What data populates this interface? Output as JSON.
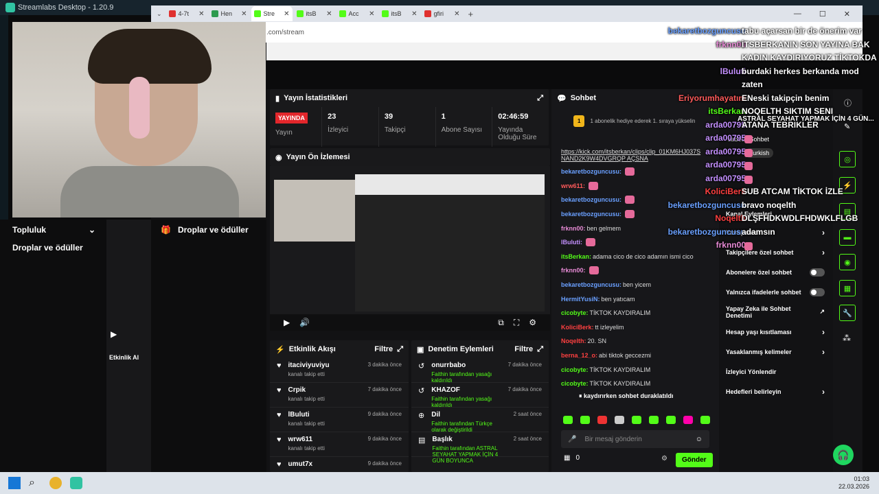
{
  "app": {
    "title": "Streamlabs Desktop - 1.20.9"
  },
  "browser": {
    "tabs": [
      "4-7t",
      "Hen",
      "Stre",
      "itsB",
      "Acc",
      "itsB",
      "gfiri"
    ],
    "url": ".com/stream"
  },
  "left": {
    "items": [
      "Topluluk",
      "Droplar ve ödüller"
    ],
    "mid_item": "Droplar ve ödüller",
    "activity_label": "Etkinlik Al"
  },
  "stats": {
    "title": "Yayın İstatistikleri",
    "live": "YAYINDA",
    "stream": "Yayın",
    "viewers_v": "23",
    "viewers": "İzleyici",
    "followers_v": "39",
    "followers": "Takipçi",
    "subs_v": "1",
    "subs": "Abone Sayısı",
    "dur_v": "02:46:59",
    "dur": "Yayında Olduğu Süre"
  },
  "preview": {
    "title": "Yayın Ön İzlemesi"
  },
  "feed": {
    "title": "Etkinlik Akışı",
    "filter": "Filtre",
    "items": [
      {
        "name": "itaciviyuviyu",
        "sub": "kanalı takip etti",
        "time": "3 dakika önce"
      },
      {
        "name": "Crpik",
        "sub": "kanalı takip etti",
        "time": "7 dakika önce"
      },
      {
        "name": "lBuluti",
        "sub": "kanalı takip etti",
        "time": "9 dakika önce"
      },
      {
        "name": "wrw611",
        "sub": "kanalı takip etti",
        "time": "9 dakika önce"
      },
      {
        "name": "umut7x",
        "sub": "",
        "time": "9 dakika önce"
      }
    ]
  },
  "mod": {
    "title": "Denetim Eylemleri",
    "filter": "Filtre",
    "items": [
      {
        "name": "onurrbabo",
        "sub": "Faithin tarafından yasağı kaldırıldı",
        "time": "7 dakika önce"
      },
      {
        "name": "KHAZOF",
        "sub": "Faithin tarafından yasağı kaldırıldı",
        "time": "7 dakika önce"
      },
      {
        "name": "Dil",
        "sub": "Faithin tarafından Türkçe olarak değiştirildi",
        "time": "2 saat önce"
      },
      {
        "name": "Başlık",
        "sub": "Faithin tarafından ASTRAL SEYAHAT YAPMAK İÇİN 4 GÜN BOYUNCA",
        "time": "2 saat önce"
      }
    ]
  },
  "chat": {
    "title": "Sohbet",
    "pinned": "1 abonelik hediye ederek 1. sıraya yükselin",
    "paused": "kaydırırken sohbet duraklatıldı",
    "placeholder": "Bir mesaj gönderin",
    "count": "0",
    "send": "Gönder",
    "messages": [
      {
        "u": "",
        "t": "https://kick.com/itsberkan/clips/clip_01KM6HJ037S NAND2K9W4DVGRQP AÇSNA",
        "c": "#ddd"
      },
      {
        "u": "bekaretbozguncusu:",
        "t": "",
        "c": "#6aa0ff"
      },
      {
        "u": "wrw611:",
        "t": "",
        "c": "#ff5a5a"
      },
      {
        "u": "bekaretbozguncusu:",
        "t": "",
        "c": "#6aa0ff"
      },
      {
        "u": "bekaretbozguncusu:",
        "t": "",
        "c": "#6aa0ff"
      },
      {
        "u": "frknn00:",
        "t": "ben gelmem",
        "c": "#e88bd6"
      },
      {
        "u": "lBuluti:",
        "t": "",
        "c": "#c490ff"
      },
      {
        "u": "itsBerkan:",
        "t": "adama cico de cico adamın ismi cico",
        "c": "#53fc18"
      },
      {
        "u": "frknn00:",
        "t": "",
        "c": "#e88bd6"
      },
      {
        "u": "bekaretbozguncusu:",
        "t": "ben yicem",
        "c": "#6aa0ff"
      },
      {
        "u": "HermitYusiN:",
        "t": "ben yatıcam",
        "c": "#6aa0ff"
      },
      {
        "u": "cicobyte:",
        "t": "TİKTOK KAYDIRALIM",
        "c": "#53fc18"
      },
      {
        "u": "KoliciBerk:",
        "t": "tt izleyelim",
        "c": "#ff4040"
      },
      {
        "u": "Noqelth:",
        "t": "20. SN",
        "c": "#ff4040"
      },
      {
        "u": "berna_12_o:",
        "t": "abi tiktok geccezmi",
        "c": "#ff4040"
      },
      {
        "u": "cicobyte:",
        "t": "TİKTOK KAYDIRALIM",
        "c": "#53fc18"
      },
      {
        "u": "cicobyte:",
        "t": "TİKTOK KAYDIRALIM",
        "c": "#53fc18"
      }
    ]
  },
  "settings": {
    "items": [
      {
        "label": "Yavaş mod",
        "type": "arrow"
      },
      {
        "label": "Takipçilere özel sohbet",
        "type": "arrow"
      },
      {
        "label": "Abonelere özel sohbet",
        "type": "toggle"
      },
      {
        "label": "Yalnızca ifadelerle sohbet",
        "type": "toggle"
      },
      {
        "label": "Yapay Zeka ile Sohbet Denetimi",
        "type": "ext"
      },
      {
        "label": "Hesap yaşı kısıtlaması",
        "type": "arrow"
      },
      {
        "label": "Yasaklanmış kelimeler",
        "type": "arrow"
      },
      {
        "label": "İzleyici Yönlendir",
        "type": "none"
      },
      {
        "label": "Hedefleri belirleyin",
        "type": "arrow"
      }
    ],
    "header": "Kanal Eylemleri",
    "lang": "Turkish",
    "only": "sadece Sohbet"
  },
  "overlay": [
    {
      "u": "bekaretbozguncusu",
      "t": "tabu açarsan bir de önerim var",
      "uc": "#6aa0ff"
    },
    {
      "u": "frknn00",
      "t": "İTSBERKANIN SON YAYINA BAK",
      "uc": "#e88bd6"
    },
    {
      "u": "",
      "t": "KADIN KAYDIRIYORUZ TİKTOKDA",
      "uc": "#fff"
    },
    {
      "u": "lBuluti",
      "t": "burdaki herkes berkanda mod",
      "uc": "#c490ff"
    },
    {
      "u": "",
      "t": "zaten",
      "uc": "#fff"
    },
    {
      "u": "Eriyorumhayatım",
      "t": "ENeski takipçin benim",
      "uc": "#ff5a5a"
    },
    {
      "u": "itsBerkan",
      "t": "NOQELTH SIKTIM SENI",
      "uc": "#53fc18"
    },
    {
      "u": "arda00795",
      "t": "ATANA TEBRIKLER",
      "uc": "#c490ff"
    },
    {
      "u": "arda00795",
      "t": "",
      "uc": "#c490ff"
    },
    {
      "u": "arda00795",
      "t": "",
      "uc": "#c490ff"
    },
    {
      "u": "arda00795",
      "t": "",
      "uc": "#c490ff"
    },
    {
      "u": "arda00795",
      "t": "",
      "uc": "#c490ff"
    },
    {
      "u": "KoliciBerk",
      "t": "SUB ATCAM TİKTOK İZLE",
      "uc": "#ff4040"
    },
    {
      "u": "bekaretbozguncusu",
      "t": "bravo noqelth",
      "uc": "#6aa0ff"
    },
    {
      "u": "Noqelth",
      "t": "DLŞFHDKWDLFHDWKLFLGB",
      "uc": "#ff4040"
    },
    {
      "u": "bekaretbozguncusu",
      "t": "adamsın",
      "uc": "#6aa0ff"
    },
    {
      "u": "frknn00",
      "t": "",
      "uc": "#e88bd6"
    }
  ],
  "overlay_extra": {
    "astral": "ASTRAL SEYAHAT YAPMAK İÇİN 4 GÜN..."
  },
  "taskbar": {
    "time": "01:03",
    "date": "22.03.2026"
  }
}
